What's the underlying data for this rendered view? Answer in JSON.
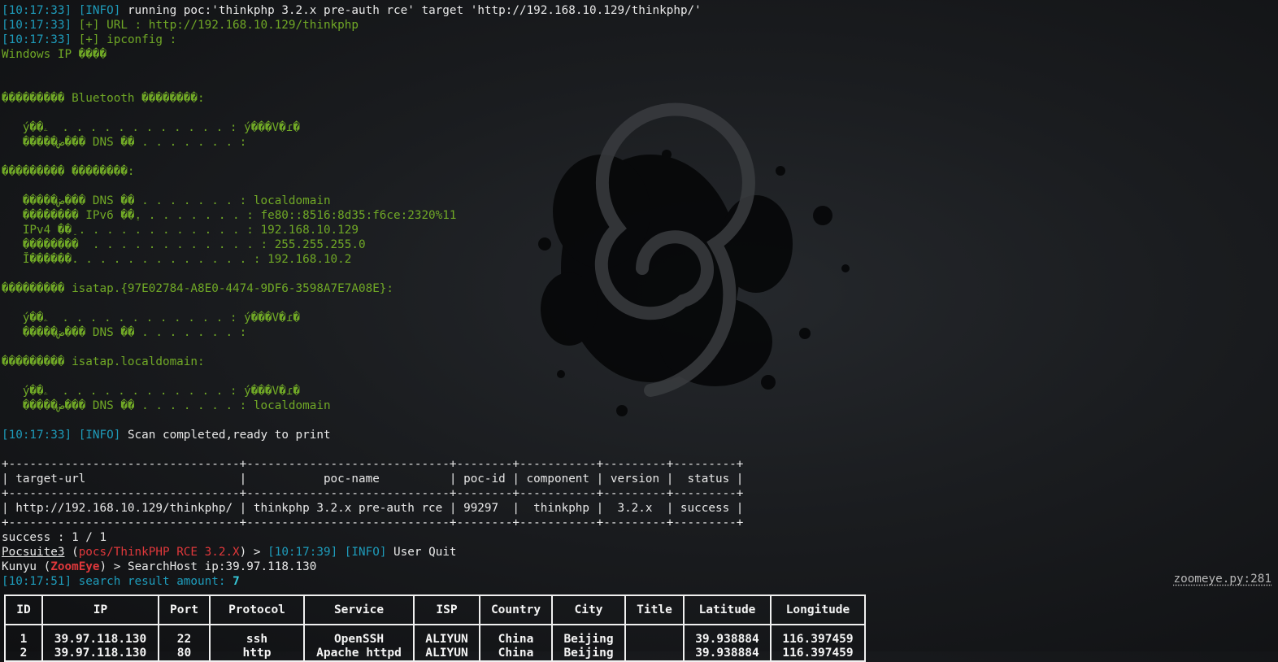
{
  "terminal": {
    "t1": "[10:17:33]",
    "t2": "[10:17:39]",
    "t3": "[10:17:51]",
    "info": "[INFO]",
    "running_msg": " running poc:'thinkphp 3.2.x pre-auth rce' target 'http://192.168.10.129/thinkphp/'",
    "url_line": " [+] URL : http://192.168.10.129/thinkphp",
    "ipconfig_line": " [+] ipconfig :",
    "ipconfig_output": [
      "Windows IP ����",
      "",
      "",
      "��������� Bluetooth ��������:",
      "",
      "   ý��ۦ  . . . . . . . . . . . . : ý���V�ɾ�",
      "   �����ض��� DNS ��׺ . . . . . . . :",
      "",
      "��������� ��������:",
      "",
      "   �����ض��� DNS ��׺ . . . . . . . : localdomain",
      "   �������� IPv6 ��ַ. . . . . . . . : fe80::8516:8d35:f6ce:2320%11",
      "   IPv4 ��ַ . . . . . . . . . . . . : 192.168.10.129",
      "   ��������  . . . . . . . . . . . . : 255.255.255.0",
      "   Ĭ������. . . . . . . . . . . . . : 192.168.10.2",
      "",
      "��������� isatap.{97E02784-A8E0-4474-9DF6-3598A7E7A08E}:",
      "",
      "   ý��ۦ  . . . . . . . . . . . . : ý���V�ɾ�",
      "   �����ض��� DNS ��׺ . . . . . . . :",
      "",
      "��������� isatap.localdomain:",
      "",
      "   ý��ۦ  . . . . . . . . . . . . : ý���V�ɾ�",
      "   �����ض��� DNS ��׺ . . . . . . . : localdomain",
      ""
    ],
    "scan_msg": " Scan completed,ready to print",
    "ascii_table": [
      "+---------------------------------+-----------------------------+--------+-----------+---------+---------+",
      "| target-url                      |           poc-name          | poc-id | component | version |  status |",
      "+---------------------------------+-----------------------------+--------+-----------+---------+---------+",
      "| http://192.168.10.129/thinkphp/ | thinkphp 3.2.x pre-auth rce | 99297  |  thinkphp |  3.2.x  | success |",
      "+---------------------------------+-----------------------------+--------+-----------+---------+---------+"
    ],
    "success_line": "success : 1 / 1",
    "pocsuite": "Pocsuite3",
    "poc_path": "pocs/ThinkPHP RCE 3.2.X",
    "user_quit": " User Quit",
    "kunyu": "Kunyu (",
    "zoomeye": "ZoomEye",
    "kunyu_cmd": ") > SearchHost ip:39.97.118.130",
    "search_amount_label": " search result amount: ",
    "search_amount": "7",
    "zoomeye_ref": "zoomeye.py:281"
  },
  "results": {
    "headers": [
      "ID",
      "IP",
      "Port",
      "Protocol",
      "Service",
      "ISP",
      "Country",
      "City",
      "Title",
      "Latitude",
      "Longitude"
    ],
    "rows": [
      [
        "1",
        "39.97.118.130",
        "22",
        "ssh",
        "OpenSSH",
        "ALIYUN",
        "China",
        "Beijing",
        "",
        "39.938884",
        "116.397459"
      ],
      [
        "2",
        "39.97.118.130",
        "80",
        "http",
        "Apache httpd",
        "ALIYUN",
        "China",
        "Beijing",
        "",
        "39.938884",
        "116.397459"
      ]
    ]
  }
}
